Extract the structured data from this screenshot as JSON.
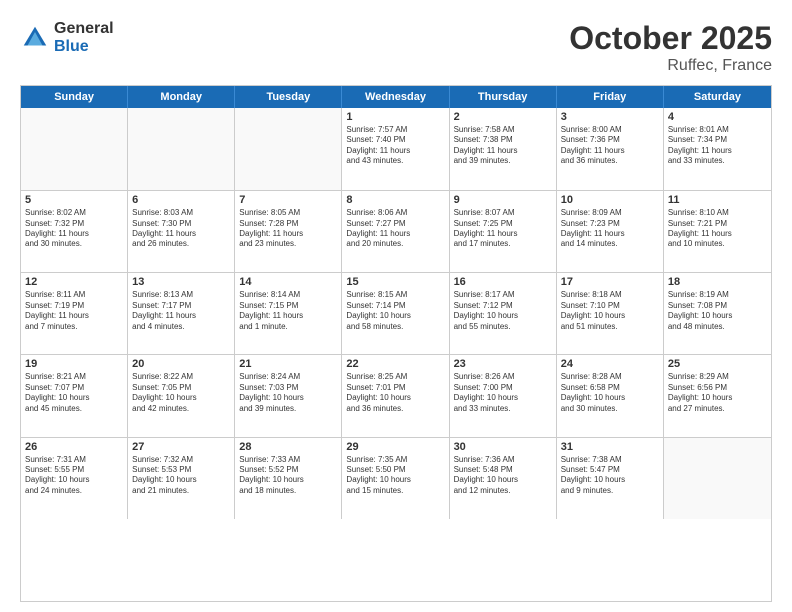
{
  "header": {
    "logo_general": "General",
    "logo_blue": "Blue",
    "month": "October 2025",
    "location": "Ruffec, France"
  },
  "days_of_week": [
    "Sunday",
    "Monday",
    "Tuesday",
    "Wednesday",
    "Thursday",
    "Friday",
    "Saturday"
  ],
  "rows": [
    [
      {
        "day": "",
        "info": ""
      },
      {
        "day": "",
        "info": ""
      },
      {
        "day": "",
        "info": ""
      },
      {
        "day": "1",
        "info": "Sunrise: 7:57 AM\nSunset: 7:40 PM\nDaylight: 11 hours\nand 43 minutes."
      },
      {
        "day": "2",
        "info": "Sunrise: 7:58 AM\nSunset: 7:38 PM\nDaylight: 11 hours\nand 39 minutes."
      },
      {
        "day": "3",
        "info": "Sunrise: 8:00 AM\nSunset: 7:36 PM\nDaylight: 11 hours\nand 36 minutes."
      },
      {
        "day": "4",
        "info": "Sunrise: 8:01 AM\nSunset: 7:34 PM\nDaylight: 11 hours\nand 33 minutes."
      }
    ],
    [
      {
        "day": "5",
        "info": "Sunrise: 8:02 AM\nSunset: 7:32 PM\nDaylight: 11 hours\nand 30 minutes."
      },
      {
        "day": "6",
        "info": "Sunrise: 8:03 AM\nSunset: 7:30 PM\nDaylight: 11 hours\nand 26 minutes."
      },
      {
        "day": "7",
        "info": "Sunrise: 8:05 AM\nSunset: 7:28 PM\nDaylight: 11 hours\nand 23 minutes."
      },
      {
        "day": "8",
        "info": "Sunrise: 8:06 AM\nSunset: 7:27 PM\nDaylight: 11 hours\nand 20 minutes."
      },
      {
        "day": "9",
        "info": "Sunrise: 8:07 AM\nSunset: 7:25 PM\nDaylight: 11 hours\nand 17 minutes."
      },
      {
        "day": "10",
        "info": "Sunrise: 8:09 AM\nSunset: 7:23 PM\nDaylight: 11 hours\nand 14 minutes."
      },
      {
        "day": "11",
        "info": "Sunrise: 8:10 AM\nSunset: 7:21 PM\nDaylight: 11 hours\nand 10 minutes."
      }
    ],
    [
      {
        "day": "12",
        "info": "Sunrise: 8:11 AM\nSunset: 7:19 PM\nDaylight: 11 hours\nand 7 minutes."
      },
      {
        "day": "13",
        "info": "Sunrise: 8:13 AM\nSunset: 7:17 PM\nDaylight: 11 hours\nand 4 minutes."
      },
      {
        "day": "14",
        "info": "Sunrise: 8:14 AM\nSunset: 7:15 PM\nDaylight: 11 hours\nand 1 minute."
      },
      {
        "day": "15",
        "info": "Sunrise: 8:15 AM\nSunset: 7:14 PM\nDaylight: 10 hours\nand 58 minutes."
      },
      {
        "day": "16",
        "info": "Sunrise: 8:17 AM\nSunset: 7:12 PM\nDaylight: 10 hours\nand 55 minutes."
      },
      {
        "day": "17",
        "info": "Sunrise: 8:18 AM\nSunset: 7:10 PM\nDaylight: 10 hours\nand 51 minutes."
      },
      {
        "day": "18",
        "info": "Sunrise: 8:19 AM\nSunset: 7:08 PM\nDaylight: 10 hours\nand 48 minutes."
      }
    ],
    [
      {
        "day": "19",
        "info": "Sunrise: 8:21 AM\nSunset: 7:07 PM\nDaylight: 10 hours\nand 45 minutes."
      },
      {
        "day": "20",
        "info": "Sunrise: 8:22 AM\nSunset: 7:05 PM\nDaylight: 10 hours\nand 42 minutes."
      },
      {
        "day": "21",
        "info": "Sunrise: 8:24 AM\nSunset: 7:03 PM\nDaylight: 10 hours\nand 39 minutes."
      },
      {
        "day": "22",
        "info": "Sunrise: 8:25 AM\nSunset: 7:01 PM\nDaylight: 10 hours\nand 36 minutes."
      },
      {
        "day": "23",
        "info": "Sunrise: 8:26 AM\nSunset: 7:00 PM\nDaylight: 10 hours\nand 33 minutes."
      },
      {
        "day": "24",
        "info": "Sunrise: 8:28 AM\nSunset: 6:58 PM\nDaylight: 10 hours\nand 30 minutes."
      },
      {
        "day": "25",
        "info": "Sunrise: 8:29 AM\nSunset: 6:56 PM\nDaylight: 10 hours\nand 27 minutes."
      }
    ],
    [
      {
        "day": "26",
        "info": "Sunrise: 7:31 AM\nSunset: 5:55 PM\nDaylight: 10 hours\nand 24 minutes."
      },
      {
        "day": "27",
        "info": "Sunrise: 7:32 AM\nSunset: 5:53 PM\nDaylight: 10 hours\nand 21 minutes."
      },
      {
        "day": "28",
        "info": "Sunrise: 7:33 AM\nSunset: 5:52 PM\nDaylight: 10 hours\nand 18 minutes."
      },
      {
        "day": "29",
        "info": "Sunrise: 7:35 AM\nSunset: 5:50 PM\nDaylight: 10 hours\nand 15 minutes."
      },
      {
        "day": "30",
        "info": "Sunrise: 7:36 AM\nSunset: 5:48 PM\nDaylight: 10 hours\nand 12 minutes."
      },
      {
        "day": "31",
        "info": "Sunrise: 7:38 AM\nSunset: 5:47 PM\nDaylight: 10 hours\nand 9 minutes."
      },
      {
        "day": "",
        "info": ""
      }
    ]
  ]
}
